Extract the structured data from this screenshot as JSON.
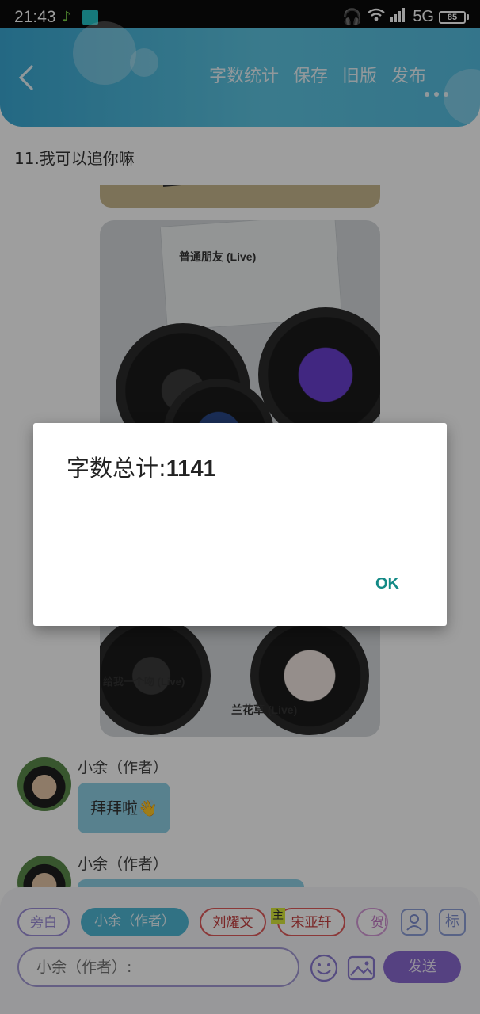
{
  "status_bar": {
    "time": "21:43",
    "network": "5G",
    "battery": "85"
  },
  "header": {
    "actions": [
      "字数统计",
      "保存",
      "旧版",
      "发布"
    ]
  },
  "chapter": {
    "title": "11.我可以追你嘛"
  },
  "image_cards": {
    "card1_title": "普通朋友 (Live)",
    "card2_title": "给我一个吻 (Live)",
    "card3_title": "兰花草 (Live)"
  },
  "messages": [
    {
      "author": "小余（作者）",
      "text": "拜拜啦👋"
    },
    {
      "author": "小余（作者）",
      "text": ""
    }
  ],
  "role_chips": {
    "items": [
      "旁白",
      "小余（作者）",
      "刘耀文",
      "宋亚轩",
      "贺峻"
    ],
    "host_tag": "主"
  },
  "square_buttons": {
    "tag": "标"
  },
  "composer": {
    "placeholder": "小余（作者）:",
    "send_label": "发送"
  },
  "dialog": {
    "label": "字数总计:",
    "count": "1141",
    "ok_label": "OK"
  },
  "colors": {
    "header_accent": "#4fb9d6",
    "send_button": "#8a6ad0",
    "ok_text": "#138a86"
  }
}
